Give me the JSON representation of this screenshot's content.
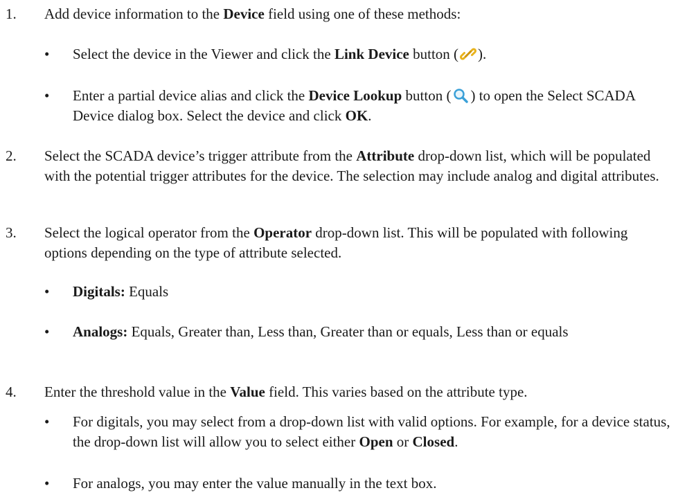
{
  "steps": [
    {
      "number": "1.",
      "pre": "Add device information to the ",
      "bold": "Device",
      "post": " field using one of these methods:",
      "bullets": [
        {
          "dot": "•",
          "pre": "Select the device in the Viewer and click the ",
          "bold": "Link Device",
          "mid": " button (",
          "icon": "link-device-icon",
          "post": ")."
        },
        {
          "dot": "•",
          "pre": "Enter a partial device alias and click the ",
          "bold": "Device Lookup",
          "mid": " button (",
          "icon": "search-icon",
          "post": ") to open the Select SCADA Device dialog box. Select the device and click ",
          "bold2": "OK",
          "end": "."
        }
      ]
    },
    {
      "number": "2.",
      "pre": "Select the SCADA device’s trigger attribute from the ",
      "bold": "Attribute",
      "post": " drop-down list, which will be populated with the potential trigger attributes for the device. The selection may include analog and digital attributes."
    },
    {
      "number": "3.",
      "pre": "Select the logical operator from the ",
      "bold": "Operator",
      "post": " drop-down list. This will be populated with following options depending on the type of attribute selected.",
      "bullets": [
        {
          "dot": "•",
          "bold": "Digitals:",
          "post": " Equals"
        },
        {
          "dot": "•",
          "bold": "Analogs:",
          "post": " Equals, Greater than, Less than, Greater than or equals, Less than or equals"
        }
      ]
    },
    {
      "number": "4.",
      "pre": "Enter the threshold value in the ",
      "bold": "Value",
      "post": " field. This varies based on the attribute type.",
      "bullets": [
        {
          "dot": "•",
          "pre": "For digitals, you may select from a drop-down list with valid options. For example, for a device status, the drop-down list will allow you to select either ",
          "bold": "Open",
          "mid": " or ",
          "bold2": "Closed",
          "end": "."
        },
        {
          "dot": "•",
          "pre": "For analogs, you may enter the value manually in the text box."
        }
      ]
    }
  ],
  "colors": {
    "text": "#1a1a1a",
    "link_icon": "#e8b21c",
    "search_icon": "#3aa0d8"
  }
}
